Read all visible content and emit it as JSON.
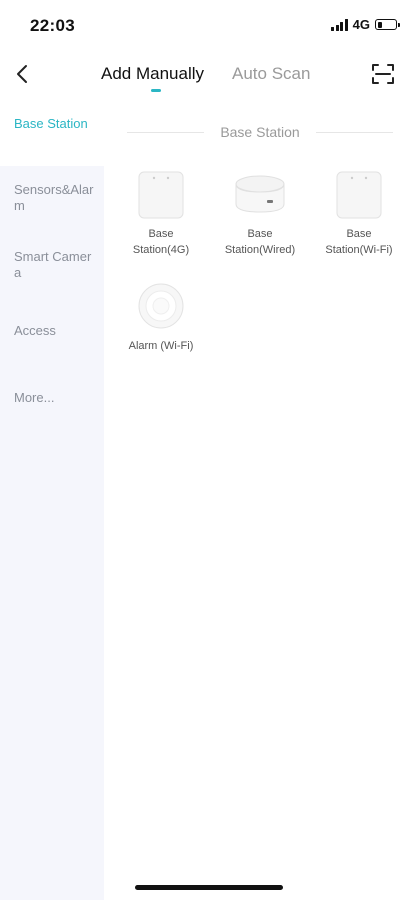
{
  "status_bar": {
    "time": "22:03",
    "network": "4G"
  },
  "nav": {
    "tabs": [
      {
        "label": "Add Manually"
      },
      {
        "label": "Auto Scan"
      }
    ]
  },
  "sidebar": {
    "items": [
      {
        "label": "Base Station"
      },
      {
        "label": "Sensors&Alarm"
      },
      {
        "label": "Smart Camera"
      },
      {
        "label": "Access"
      },
      {
        "label": "More..."
      }
    ]
  },
  "section": {
    "title": "Base Station"
  },
  "devices": [
    {
      "label_line1": "Base",
      "label_line2": "Station(4G)"
    },
    {
      "label_line1": "Base",
      "label_line2": "Station(Wired)"
    },
    {
      "label_line1": "Base",
      "label_line2": "Station(Wi-Fi)"
    },
    {
      "label_line1": "Alarm (Wi-Fi)",
      "label_line2": ""
    }
  ],
  "colors": {
    "accent": "#2bb6c4",
    "sidebar_bg": "#f5f6fc"
  }
}
